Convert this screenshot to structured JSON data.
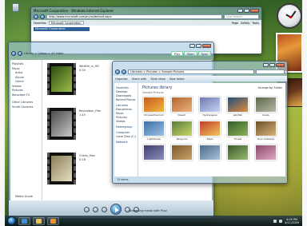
{
  "desktop": {
    "recycle_bin_label": "Recycle Bin"
  },
  "ie_window": {
    "title": "Microsoft Corporation - Windows Internet Explorer",
    "address": "http://www.microsoft.com/en/us/default.aspx",
    "search_placeholder": "Live Search",
    "favorites_label": "Favorites",
    "tab_label": "Microsoft Corporation",
    "commands": [
      "Page",
      "Safety",
      "Tools"
    ],
    "site_bar": "Microsoft Corporation"
  },
  "media_window": {
    "breadcrumb": "Library > Videos > All Video",
    "tabs": [
      "Play",
      "Burn",
      "Sync"
    ],
    "active_tab": "Play",
    "nav_items": [
      {
        "label": "Playlists",
        "level": 0
      },
      {
        "label": "Music",
        "level": 0
      },
      {
        "label": "Artist",
        "level": 1
      },
      {
        "label": "Album",
        "level": 1
      },
      {
        "label": "Genre",
        "level": 1
      },
      {
        "label": "Videos",
        "level": 0
      },
      {
        "label": "Pictures",
        "level": 0
      },
      {
        "label": "Recorded TV",
        "level": 0
      },
      {
        "label": "",
        "level": -1
      },
      {
        "label": "Other Libraries",
        "level": 0
      },
      {
        "label": "Smith Libraries",
        "level": 0
      }
    ],
    "videos": [
      {
        "title": "Wildlife_in_HD",
        "duration": "0:30",
        "frame_color": "#6b8b2a"
      },
      {
        "title": "Revelation_Film",
        "duration": "1:45",
        "frame_color": "#8a8a8a"
      },
      {
        "title": "Chairs_Mov",
        "duration": "0:18",
        "frame_color": "#b9b08a"
      }
    ],
    "media_guide_label": "Media Guide",
    "status_text": "Streaming media with Plus!"
  },
  "pictures_window": {
    "address": "Libraries > Pictures > Sample Pictures",
    "commands": [
      "Organize",
      "Share with",
      "Slide show",
      "New folder"
    ],
    "nav_sections": [
      {
        "label": "Favorites",
        "header": true
      },
      {
        "label": "Desktop",
        "header": false
      },
      {
        "label": "Downloads",
        "header": false
      },
      {
        "label": "Recent Places",
        "header": false
      },
      {
        "label": "Libraries",
        "header": true
      },
      {
        "label": "Documents",
        "header": false
      },
      {
        "label": "Music",
        "header": false
      },
      {
        "label": "Pictures",
        "header": false
      },
      {
        "label": "Videos",
        "header": false
      },
      {
        "label": "Homegroup",
        "header": true
      },
      {
        "label": "Computer",
        "header": true
      },
      {
        "label": "Local Disk (C:)",
        "header": false
      },
      {
        "label": "Network",
        "header": true
      }
    ],
    "library_title": "Pictures library",
    "library_subtitle": "Sample Pictures",
    "arrange_label": "Arrange by: Folder",
    "thumbnails": [
      {
        "caption": "Chrysanthemum",
        "color_a": "#c75a1f",
        "color_b": "#f1b640"
      },
      {
        "caption": "Desert",
        "color_a": "#b8642f",
        "color_b": "#e6b37a"
      },
      {
        "caption": "Hydrangeas",
        "color_a": "#6f7bb3",
        "color_b": "#c7d0f0"
      },
      {
        "caption": "Jellyfish",
        "color_a": "#1f4f7e",
        "color_b": "#e28c3a"
      },
      {
        "caption": "Koala",
        "color_a": "#5a6b4a",
        "color_b": "#b7b6a8"
      },
      {
        "caption": "Lighthouse",
        "color_a": "#3c6ea8",
        "color_b": "#9bc1e2"
      },
      {
        "caption": "Penguins",
        "color_a": "#5b7d39",
        "color_b": "#c8d86a"
      },
      {
        "caption": "Tulips",
        "color_a": "#c23c2a",
        "color_b": "#f0c75c"
      },
      {
        "caption": "Forest",
        "color_a": "#2f5f2a",
        "color_b": "#8fb05a"
      },
      {
        "caption": "Oryx Antelope",
        "color_a": "#6b4f2a",
        "color_b": "#d9b37a"
      },
      {
        "caption": "",
        "color_a": "#3f3f6a",
        "color_b": "#8c8cbf"
      },
      {
        "caption": "",
        "color_a": "#7a5a2a",
        "color_b": "#c9a46a"
      },
      {
        "caption": "",
        "color_a": "#4a6a8a",
        "color_b": "#a9c2d8"
      },
      {
        "caption": "",
        "color_a": "#3a5a2a",
        "color_b": "#9ab870"
      },
      {
        "caption": "",
        "color_a": "#8a4a6a",
        "color_b": "#e0a8c0"
      }
    ],
    "status_text": "15 items"
  },
  "taskbar": {
    "buttons": [
      {
        "name": "ie",
        "color": "#3b8fd8"
      },
      {
        "name": "explorer",
        "color": "#e8c255"
      },
      {
        "name": "media-player",
        "color": "#f0902a"
      }
    ],
    "time": "4:05 PM",
    "date": "4/11/2009"
  }
}
